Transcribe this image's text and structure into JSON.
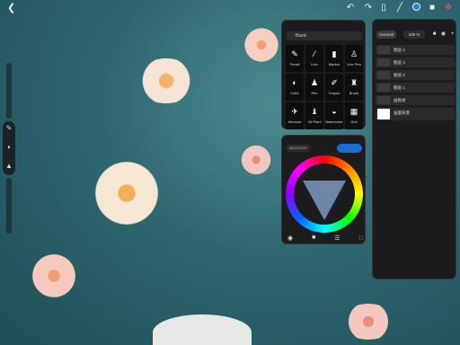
{
  "topbar": {
    "back_icon": "chevron-left-icon",
    "icons": [
      "undo-icon",
      "redo-icon",
      "tool-icon",
      "brush-icon",
      "color-circle-icon",
      "layers-icon",
      "gift-icon"
    ]
  },
  "brushes": {
    "category": "Basic",
    "items": [
      {
        "label": "Pencil",
        "icon": "pencil-icon"
      },
      {
        "label": "Line",
        "icon": "line-icon"
      },
      {
        "label": "Marker",
        "icon": "marker-icon"
      },
      {
        "label": "Line Pen",
        "icon": "line-pen-icon"
      },
      {
        "label": "Color",
        "icon": "color-brush-icon"
      },
      {
        "label": "Pen",
        "icon": "pen-icon"
      },
      {
        "label": "Crayon",
        "icon": "crayon-icon"
      },
      {
        "label": "Brush",
        "icon": "brush-icon"
      },
      {
        "label": "Airbrush",
        "icon": "airbrush-icon"
      },
      {
        "label": "Oil Paint",
        "icon": "oil-paint-icon"
      },
      {
        "label": "Watercolor",
        "icon": "watercolor-icon"
      },
      {
        "label": "Grid",
        "icon": "grid-icon"
      }
    ]
  },
  "color_panel": {
    "hex": "#CCCCCC",
    "accent": "#1d6bd6"
  },
  "layers_panel": {
    "mode": "General",
    "opacity": "100 %",
    "layers": [
      "图层 4",
      "图层 3",
      "图层 2",
      "图层 1",
      "画板组",
      "画面背景"
    ]
  }
}
